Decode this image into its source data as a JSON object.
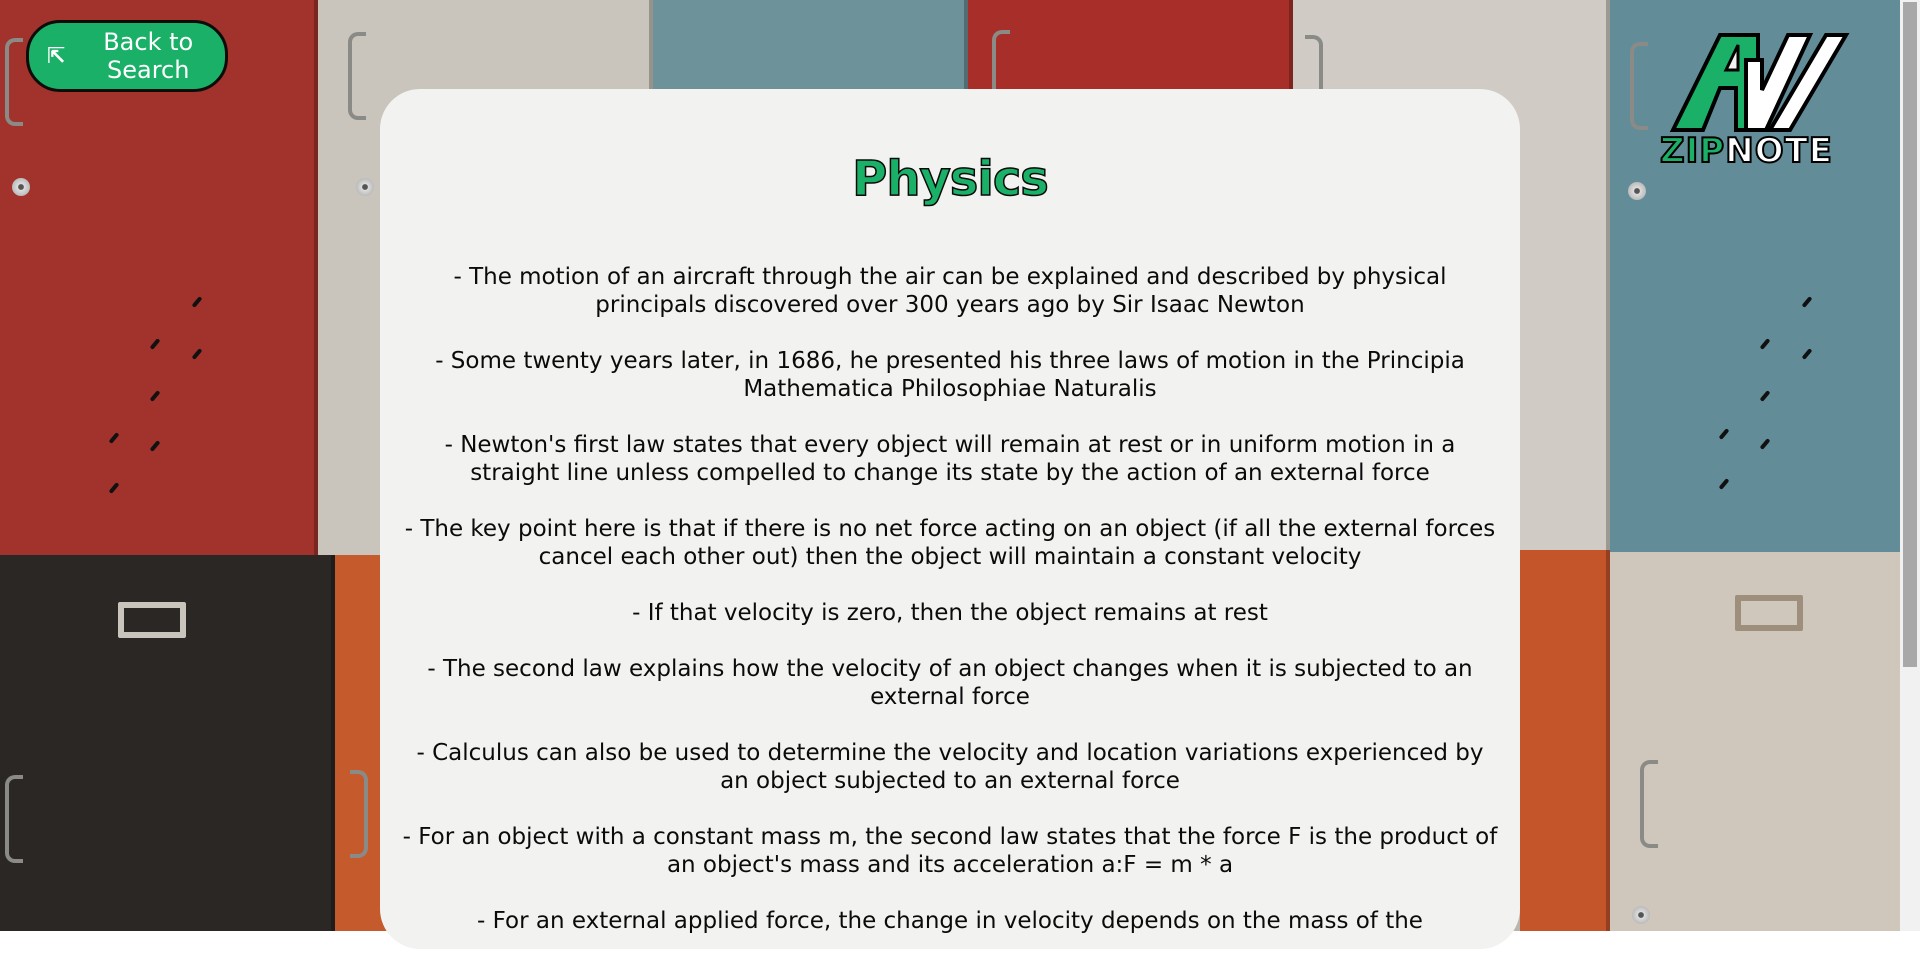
{
  "back_button": {
    "arrow": "⇱",
    "label": "Back to Search"
  },
  "logo": {
    "zip": "ZIP",
    "note": "NOTE",
    "icon": "zipnote-logo-icon"
  },
  "colors": {
    "accent": "#1ab067",
    "card": "#f2f2f0",
    "text": "#0b0b0b"
  },
  "page": {
    "title": "Physics",
    "notes": [
      "- The motion of an aircraft through the air can be explained and described by physical principals discovered over 300 years ago by Sir Isaac Newton",
      "- Some twenty years later, in 1686, he presented his three laws of motion in the Principia Mathematica Philosophiae Naturalis",
      "- Newton's first law states that every object will remain at rest or in uniform motion in a straight line unless compelled to change its state by the action of an external force",
      "- The key point here is that if there is no net force acting on an object (if all the external forces cancel each other out) then the object will maintain a constant velocity",
      "- If that velocity is zero, then the object remains at rest",
      "- The second law explains how the velocity of an object changes when it is subjected to an external force",
      "- Calculus can also be used to determine the velocity and location variations experienced by an object subjected to an external force",
      "- For an object with a constant mass m, the second law states that the force F is the product of an object's mass and its acceleration a:F = m * a",
      "- For an external applied force, the change in velocity depends on the mass of the"
    ]
  }
}
